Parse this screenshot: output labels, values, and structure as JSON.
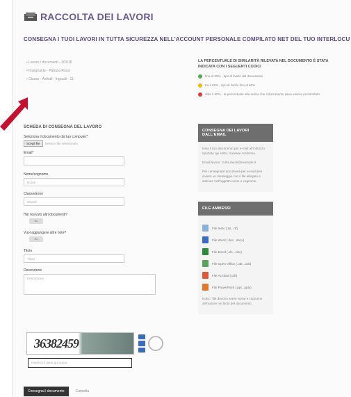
{
  "header": {
    "title": "RACCOLTA DEI LAVORI",
    "subtitle": "CONSEGNA I TUOI LAVORI IN TUTTA SICUREZZA NELL'ACCOUNT PERSONALE COMPILATO NET DEL TUO INTERLOCUTORE"
  },
  "meta": [
    "Lavoro / documenti - 3/2015",
    "Insegnante - Patrizia Rossi",
    "Classe - Awhall - Ingraali - 11"
  ],
  "compat": {
    "title": "LA PERCENTUALE DI SIMILARITÀ RILEVATA NEL DOCUMENTO È STATA INDICATA CON I SEGUENTI CODICI",
    "rows": [
      {
        "color": "#4caf50",
        "text": "fino al 25% - tipo di livello del documento"
      },
      {
        "color": "#f5b800",
        "text": "tra il 25% - tipo di livello fino al 50%"
      },
      {
        "color": "#e53935",
        "text": "oltre il 50% - la percentuale alta indica che il documento deve essere ricontrollato"
      }
    ]
  },
  "form": {
    "title": "SCHEDA DI CONSEGNA DEL LAVORO",
    "file_label": "Seleziona il documento dal tuo computer",
    "file_button": "Scegli file",
    "file_status": "Nessun file selezionato",
    "email_label": "Email",
    "surname_label": "Nome/cognome",
    "surname_placeholder": "Nome",
    "class_label": "Classe/anno",
    "class_placeholder": "Classe",
    "q1_label": "Hai ricevuto altri documenti?",
    "q1_value": "No",
    "q2_label": "Vuoi aggiungere altre note?",
    "q2_value": "No",
    "title_label": "Titolo",
    "title_placeholder": "Titolo",
    "desc_label": "Descrizione",
    "desc_placeholder": "Descrizione",
    "captcha_text": "36382459",
    "captcha_placeholder": "Inserisci il testo qui sopra",
    "submit_label": "Consegna il documento",
    "cancel_label": "Cancella"
  },
  "sidebar": {
    "head1": "CONSEGNA DEI LAVORI DALL'EMAIL",
    "p1": "Invia il tuo documento per e-mail all'indirizzo riportato qui sotto, riceverai conferma.",
    "p2": "Email lavoro: rcolta.lavori@example.it",
    "p3": "Per consegnare documenti per e-mail devi inviare un messaggio con il file allegato e indicare nell'oggetto nome e cognome.",
    "head2": "FILE AMMESSI",
    "files": [
      {
        "color": "#8ab0d8",
        "label": "File testo (.txt, .rtf)"
      },
      {
        "color": "#3a6bc0",
        "label": "File Word (.doc, .docx)"
      },
      {
        "color": "#2e8b3a",
        "label": "File Excel (.xls, .xlsx)"
      },
      {
        "color": "#5aa35a",
        "label": "File Open Office (.odt, .ods)"
      },
      {
        "color": "#e05a3a",
        "label": "File Acrobat (.pdf)"
      },
      {
        "color": "#e07a2a",
        "label": "File PowerPoint (.ppt, .pptx)"
      }
    ],
    "note": "Nota: i file devono avere nome e cognome dell'autore nel titolo del documento."
  }
}
